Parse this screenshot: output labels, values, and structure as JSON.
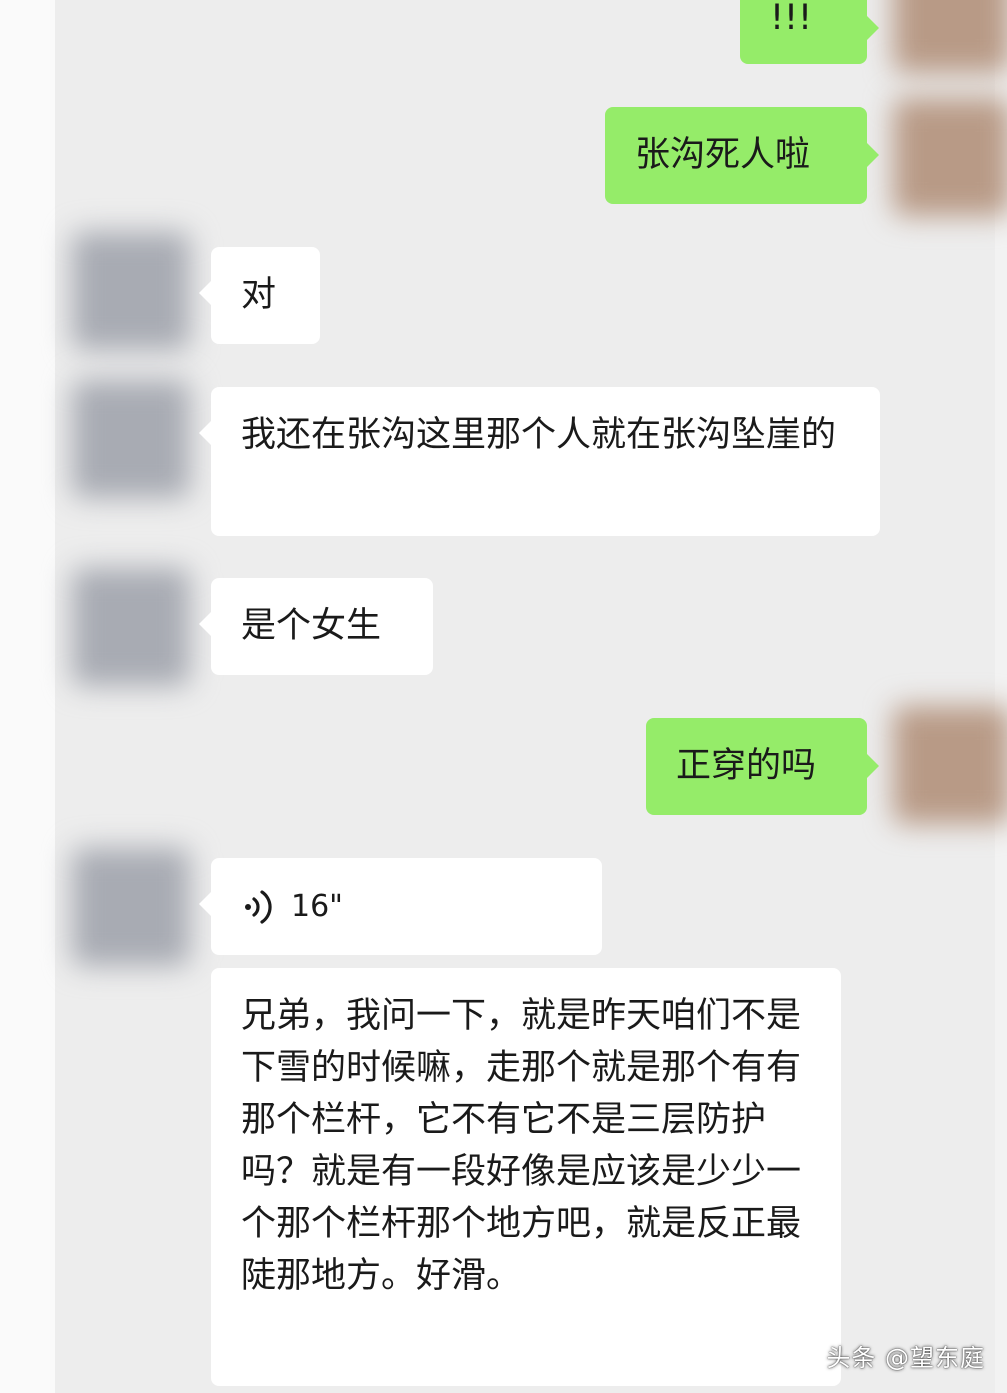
{
  "chat": {
    "messages": [
      {
        "side": "out",
        "type": "text",
        "text": "!!!"
      },
      {
        "side": "out",
        "type": "text",
        "text": "张沟死人啦"
      },
      {
        "side": "in",
        "type": "text",
        "text": "对"
      },
      {
        "side": "in",
        "type": "text",
        "text": "我还在张沟这里那个人就在张沟坠崖的"
      },
      {
        "side": "in",
        "type": "text",
        "text": "是个女生"
      },
      {
        "side": "out",
        "type": "text",
        "text": "正穿的吗"
      },
      {
        "side": "in",
        "type": "voice",
        "duration": "16\""
      },
      {
        "side": "in",
        "type": "text",
        "text": "兄弟，我问一下，就是昨天咱们不是下雪的时候嘛，走那个就是那个有有那个栏杆，它不有它不是三层防护吗？就是有一段好像是应该是少少一个那个栏杆那个地方吧，就是反正最陡那地方。好滑。"
      }
    ]
  },
  "colors": {
    "outgoing_bubble": "#95ec69",
    "incoming_bubble": "#ffffff",
    "background": "#ededed"
  },
  "icons": {
    "voice": "voice-wave-icon"
  },
  "watermark": "头条 @望东庭"
}
